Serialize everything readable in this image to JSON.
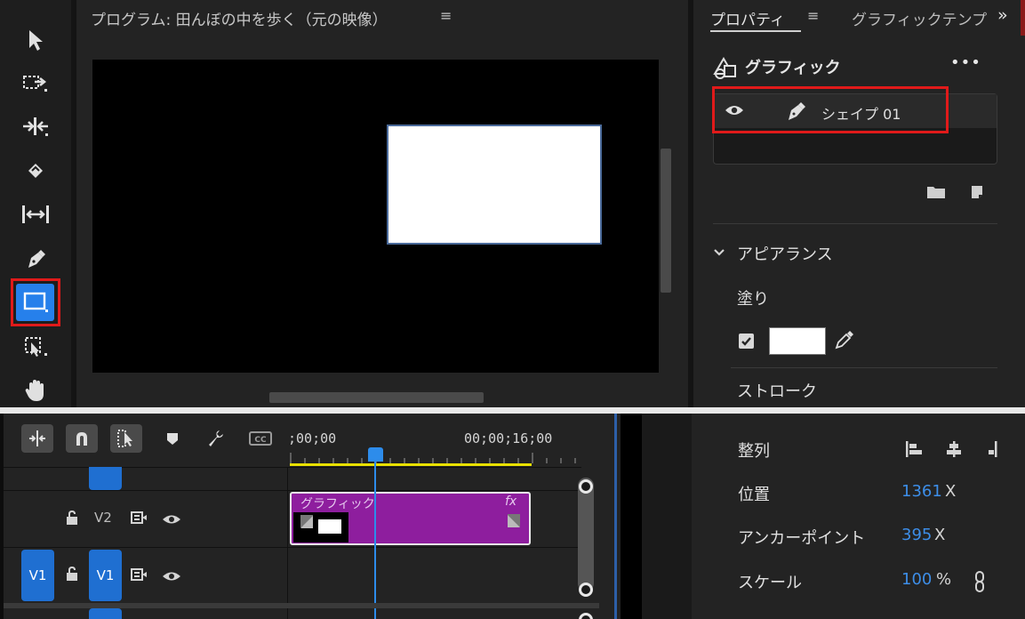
{
  "program_monitor": {
    "title": "プログラム: 田んぼの中を歩く（元の映像）",
    "menu_glyph": "≡"
  },
  "toolbar": {
    "tools": [
      "selection-tool",
      "track-select-tool",
      "ripple-edit-tool",
      "razor-tool",
      "slip-tool",
      "pen-tool",
      "rectangle-tool",
      "hand-tool",
      "type-tool"
    ],
    "active_tool": "rectangle-tool",
    "active_color": "#2680eb"
  },
  "properties_panel": {
    "tab_label": "プロパティ",
    "tab_menu_glyph": "≡",
    "second_tab_label": "グラフィックテンプレート",
    "overflow_glyph": "»",
    "graphic_header": "グラフィック",
    "more_glyph": "•••",
    "layer": {
      "name": "シェイプ 01"
    },
    "appearance_label": "アピアランス",
    "fill_label": "塗り",
    "fill_enabled": true,
    "fill_color": "#ffffff",
    "stroke_label": "ストローク"
  },
  "timeline": {
    "timecode_start": ";00;00",
    "timecode_end": "00;00;16;00",
    "tracks": [
      {
        "source_patch": "",
        "target": "V2",
        "locked": false
      },
      {
        "source_patch": "V1",
        "target": "V1",
        "locked": false
      }
    ],
    "clip": {
      "label": "グラフィック",
      "fx_badge": "fx",
      "color": "#8e1e9e"
    },
    "playhead_color": "#2d8ceb",
    "work_area_color": "#e8e000"
  },
  "properties_transform": {
    "align_label": "整列",
    "position_label": "位置",
    "position_x": "1361",
    "position_unit": "X",
    "anchor_label": "アンカーポイント",
    "anchor_x": "395",
    "anchor_unit": "X",
    "scale_label": "スケール",
    "scale_value": "100",
    "scale_unit": "%",
    "value_color": "#3d8ee8"
  }
}
